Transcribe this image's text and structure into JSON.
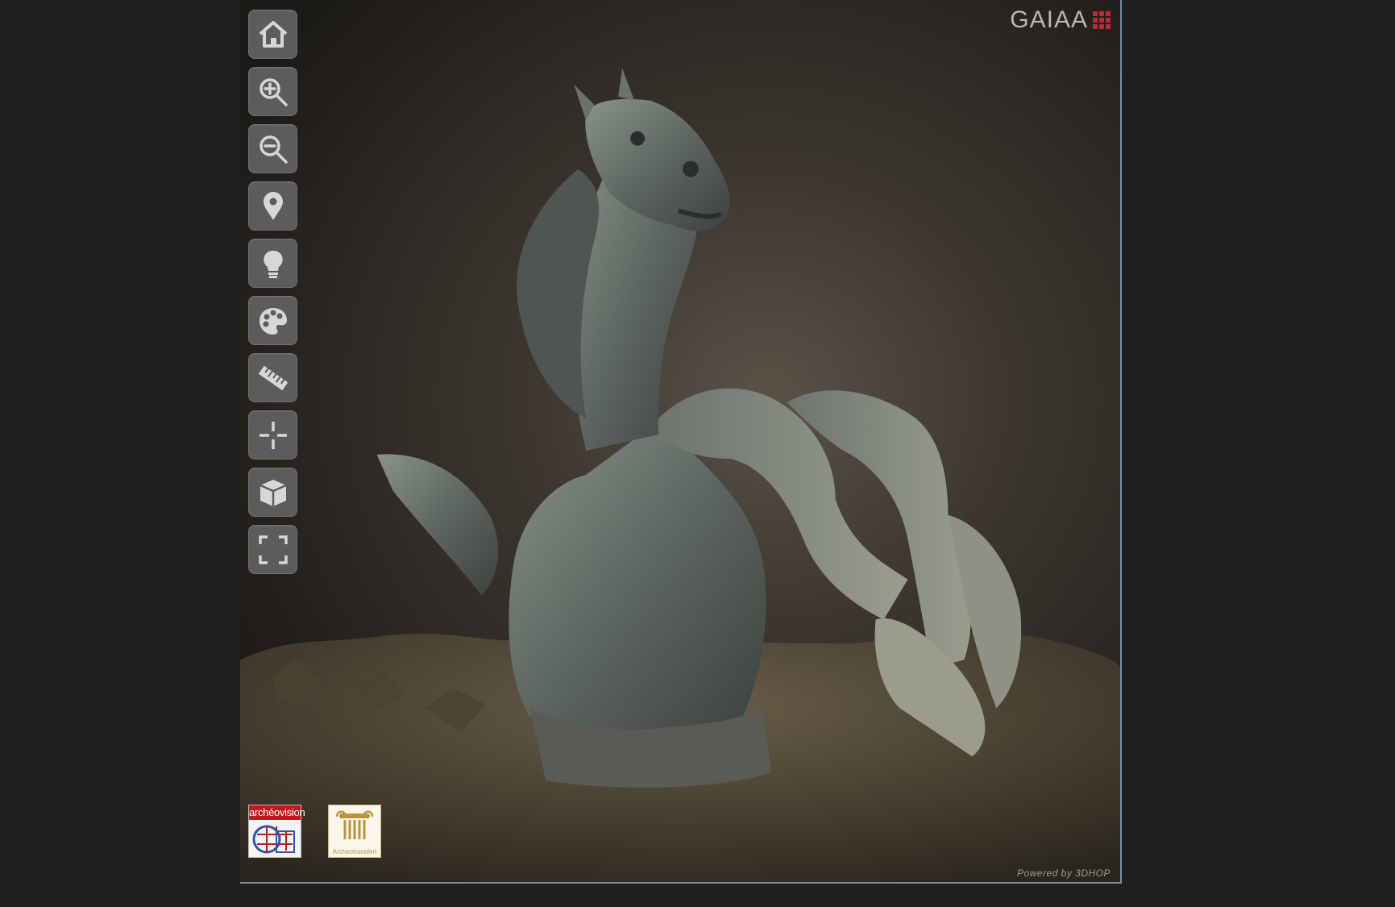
{
  "toolbar": {
    "buttons": [
      {
        "name": "home-icon",
        "title": "Home"
      },
      {
        "name": "zoom-in-icon",
        "title": "Zoom In"
      },
      {
        "name": "zoom-out-icon",
        "title": "Zoom Out"
      },
      {
        "name": "hotspot-icon",
        "title": "Hotspots"
      },
      {
        "name": "light-icon",
        "title": "Light"
      },
      {
        "name": "color-palette-icon",
        "title": "Color"
      },
      {
        "name": "measure-ruler-icon",
        "title": "Measure"
      },
      {
        "name": "pick-point-icon",
        "title": "Pick Point"
      },
      {
        "name": "cube-icon",
        "title": "Sections"
      },
      {
        "name": "fullscreen-icon",
        "title": "Full Screen"
      }
    ]
  },
  "branding": {
    "text": "GAIAA",
    "accent_color": "#c0283a"
  },
  "logos": {
    "archeovision": "archéovision",
    "archeotransfert": "Archeotransfert"
  },
  "footer": {
    "powered_by": "Powered by 3DHOP"
  },
  "colors": {
    "viewer_bg": "#3c362f",
    "page_bg": "#1f1f1f",
    "button_bg": "#5c5c5c",
    "border": "#6f8fb0"
  }
}
